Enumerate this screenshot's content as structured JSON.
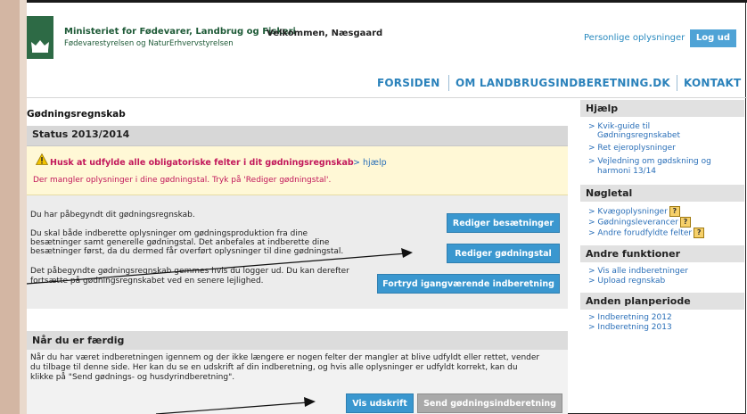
{
  "header": {
    "ministry": "Ministeriet for Fødevarer, Landbrug og Fiskeri",
    "agency": "Fødevarestyrelsen og NaturErhvervstyrelsen",
    "welcome": "Velkommen, Næsgaard",
    "personal_link": "Personlige oplysninger",
    "logout": "Log ud"
  },
  "nav": {
    "home": "FORSIDEN",
    "about": "OM LANDBRUGSINDBERETNING.DK",
    "contact": "KONTAKT"
  },
  "page_title": "Gødningsregnskab",
  "status": {
    "title": "Status 2013/2014",
    "warning_title": "Husk at udfylde alle obligatoriske felter i dit gødningsregnskab",
    "help": "hjælp",
    "warning_text": "Der mangler oplysninger i dine gødningstal. Tryk på 'Rediger gødningstal'.",
    "p1": "Du har påbegyndt dit gødningsregnskab.",
    "p2_lines": [
      "Du skal både indberette oplysninger om gødningsproduktion fra dine",
      "besætninger samt generelle gødningstal. Det anbefales at indberette dine",
      "besætninger først, da du dermed får overført oplysninger til dine gødningstal."
    ],
    "p3_lines": [
      "Det påbegyndte gødningsregnskab gemmes hvis du logger ud. Du kan derefter",
      "fortsætte på gødningsregnskabet ved en senere lejlighed."
    ],
    "btn_herds": "Rediger besætninger",
    "btn_numbers": "Rediger gødningstal",
    "btn_cancel": "Fortryd igangværende indberetning"
  },
  "done": {
    "title": "Når du er færdig",
    "lines": [
      "Når du har været indberetningen igennem og der ikke længere er nogen felter der mangler at blive udfyldt eller rettet, vender",
      "du tilbage til denne side. Her kan du se en udskrift af din indberetning, og hvis alle oplysninger er udfyldt korrekt, kan du",
      "klikke på \"Send gødnings- og husdyrindberetning\"."
    ],
    "btn_print": "Vis udskrift",
    "btn_send": "Send gødningsindberetning"
  },
  "sidebar": {
    "help_title": "Hjælp",
    "help_links": [
      [
        "Kvik-guide til",
        "Gødningsregnskabet"
      ],
      [
        "Ret ejeroplysninger"
      ],
      [
        "Vejledning om gødskning og",
        "harmoni 13/14"
      ]
    ],
    "key_title": "Nøgletal",
    "key_links": [
      "Kvægoplysninger",
      "Gødningsleverancer",
      "Andre forudfyldte felter"
    ],
    "other_title": "Andre funktioner",
    "other_links": [
      "Vis alle indberetninger",
      "Upload regnskab"
    ],
    "period_title": "Anden planperiode",
    "period_links": [
      "Indberetning 2012",
      "Indberetning 2013"
    ],
    "link_marker": ">",
    "info_glyph": "?"
  }
}
